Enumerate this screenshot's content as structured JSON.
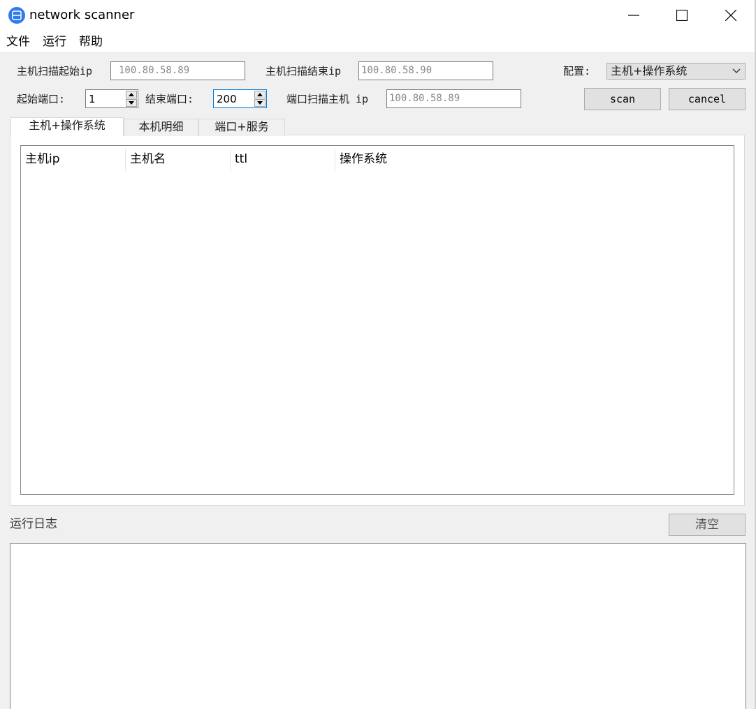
{
  "window": {
    "title": "network scanner",
    "icon": "network-scanner-app-icon"
  },
  "menu": [
    {
      "label": "文件"
    },
    {
      "label": "运行"
    },
    {
      "label": "帮助"
    }
  ],
  "controls": {
    "host_start_ip_label": "主机扫描起始ip",
    "host_start_ip_placeholder": "100.80.58.89",
    "host_end_ip_label": "主机扫描结束ip",
    "host_end_ip_placeholder": "100.80.58.90",
    "config_label": "配置:",
    "config_value": "主机+操作系统",
    "start_port_label": "起始端口:",
    "start_port_value": "1",
    "end_port_label": "结束端口:",
    "end_port_value": "200",
    "port_scan_host_label": "端口扫描主机 ip",
    "port_scan_host_placeholder": "100.80.58.89",
    "scan_label": "scan",
    "cancel_label": "cancel"
  },
  "tabs": [
    {
      "label": "主机+操作系统",
      "active": true
    },
    {
      "label": "本机明细",
      "active": false
    },
    {
      "label": "端口+服务",
      "active": false
    }
  ],
  "table": {
    "columns": [
      "主机ip",
      "主机名",
      "ttl",
      "操作系统"
    ],
    "rows": []
  },
  "log": {
    "label": "运行日志",
    "clear_label": "清空",
    "content": ""
  },
  "colors": {
    "accent_focus": "#0078d7",
    "app_icon": "#2f7bf0"
  }
}
